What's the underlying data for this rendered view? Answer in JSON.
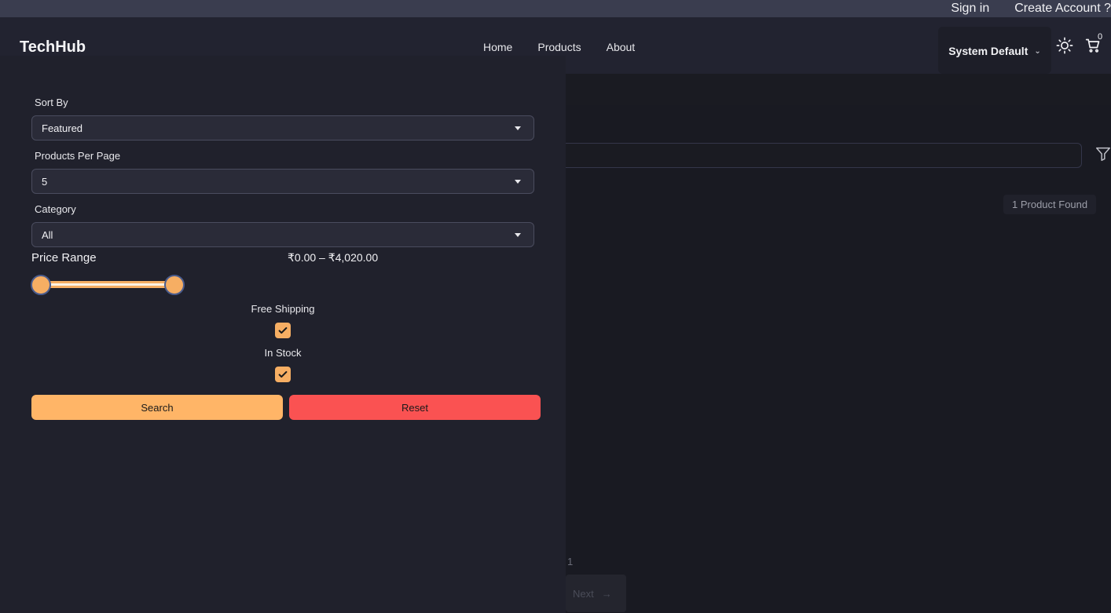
{
  "auth": {
    "sign_in": "Sign in",
    "create_account": "Create Account ?"
  },
  "header": {
    "brand": "TechHub",
    "nav": [
      "Home",
      "Products",
      "About"
    ],
    "theme": "System Default",
    "cart_count": "0"
  },
  "background": {
    "results": "1 Product Found",
    "page_number": "1",
    "next": "Next"
  },
  "filters": {
    "sort_by": {
      "label": "Sort By",
      "value": "Featured"
    },
    "per_page": {
      "label": "Products Per Page",
      "value": "5"
    },
    "category": {
      "label": "Category",
      "value": "All"
    },
    "price": {
      "label": "Price Range",
      "value": "₹0.00 – ₹4,020.00",
      "min": 0,
      "max": 4020
    },
    "free_shipping": {
      "label": "Free Shipping",
      "checked": true
    },
    "in_stock": {
      "label": "In Stock",
      "checked": true
    },
    "search_label": "Search",
    "reset_label": "Reset"
  },
  "colors": {
    "accent": "#ffb567",
    "danger": "#fa5252",
    "drawer": "#20212c",
    "page": "#191a22"
  }
}
